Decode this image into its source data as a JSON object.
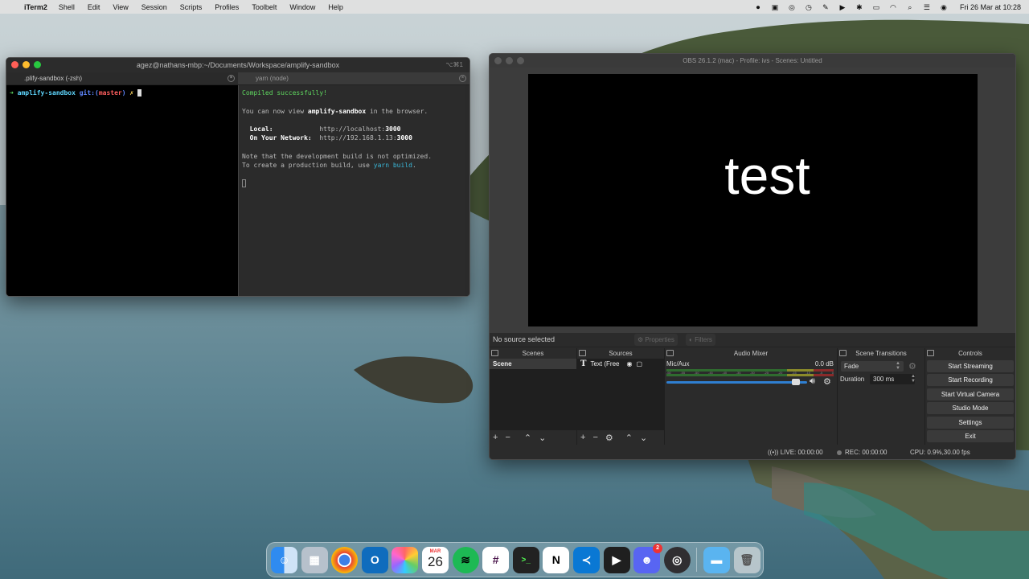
{
  "menubar": {
    "app_name": "iTerm2",
    "menus": [
      "Shell",
      "Edit",
      "View",
      "Session",
      "Scripts",
      "Profiles",
      "Toolbelt",
      "Window",
      "Help"
    ],
    "clock": "Fri 26 Mar at 10:28"
  },
  "iterm": {
    "title": "agez@nathans-mbp:~/Documents/Workspace/amplify-sandbox",
    "shortcut": "⌥⌘1",
    "tabs": [
      ".plify-sandbox (-zsh)",
      "yarn (node)"
    ],
    "left_pane": {
      "arrow": "➜",
      "dir": "amplify-sandbox",
      "git": "git:(",
      "branch": "master",
      "git_close": ")",
      "dirty": "✗"
    },
    "right_pane": {
      "compiled": "Compiled successfully!",
      "view_prefix": "You can now view ",
      "app": "amplify-sandbox",
      "view_suffix": " in the browser.",
      "local_label": "  Local:",
      "local_url": "http://localhost:",
      "local_port": "3000",
      "network_label": "  On Your Network:",
      "network_url": "http://192.168.1.13:",
      "network_port": "3000",
      "note": "Note that the development build is not optimized.",
      "prod_prefix": "To create a production build, use ",
      "prod_cmd": "yarn build",
      "prod_suffix": "."
    }
  },
  "obs": {
    "title": "OBS 26.1.2 (mac) - Profile: ivs - Scenes: Untitled",
    "preview_text": "test",
    "no_source": "No source selected",
    "properties_btn": "Properties",
    "filters_btn": "Filters",
    "docks": {
      "scenes": "Scenes",
      "sources": "Sources",
      "mixer": "Audio Mixer",
      "transitions": "Scene Transitions",
      "controls": "Controls"
    },
    "scene_item": "Scene",
    "source_item": "Text (Free",
    "mixer": {
      "channel": "Mic/Aux",
      "level": "0.0 dB",
      "ticks": [
        "-60",
        "-55",
        "-50",
        "-45",
        "-40",
        "-35",
        "-30",
        "-25",
        "-20",
        "-15",
        "-10",
        "-5",
        "0"
      ],
      "volume_fraction": 0.95
    },
    "transitions": {
      "selected": "Fade",
      "duration_label": "Duration",
      "duration_value": "300 ms"
    },
    "controls": [
      "Start Streaming",
      "Start Recording",
      "Start Virtual Camera",
      "Studio Mode",
      "Settings",
      "Exit"
    ],
    "status": {
      "live": "LIVE: 00:00:00",
      "rec": "REC: 00:00:00",
      "cpu": "CPU: 0.9%,30.00 fps"
    }
  },
  "dock": {
    "calendar_month": "MAR",
    "calendar_day": "26",
    "discord_badge": "2",
    "apps": [
      "finder",
      "launchpad",
      "chrome",
      "outlook",
      "photos",
      "calendar",
      "spotify",
      "slack",
      "terminal",
      "notion",
      "vscode",
      "plex",
      "discord",
      "obs",
      "folder",
      "trash"
    ]
  }
}
